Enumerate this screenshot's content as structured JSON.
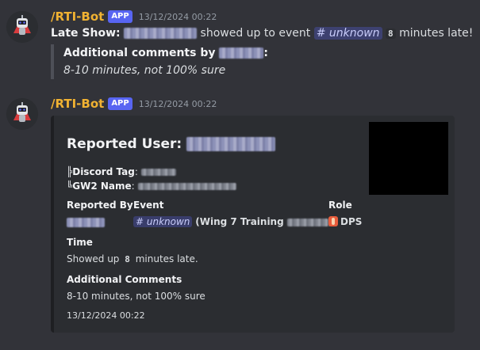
{
  "messages": [
    {
      "username": "/RTI-Bot",
      "badge": "APP",
      "timestamp": "13/12/2024 00:22",
      "content": {
        "late_show_label": "Late Show:",
        "showed_up_text": "showed up to event",
        "event_mention": "# unknown",
        "minutes_value": "8",
        "minutes_late_text": "minutes late!",
        "quote_title": "Additional comments by",
        "quote_colon": ":",
        "quote_text": "8-10 minutes, not 100% sure"
      }
    },
    {
      "username": "/RTI-Bot",
      "badge": "APP",
      "timestamp": "13/12/2024 00:22",
      "embed": {
        "title": "Reported User:",
        "discord_tag_label": "Discord Tag",
        "discord_tag_sep": ":",
        "gw2_name_label": "GW2 Name",
        "gw2_name_sep": ":",
        "tree_glyph_1": "╠",
        "tree_glyph_2": "╚",
        "reported_by_label": "Reported By",
        "event_label": "Event",
        "event_mention": "# unknown",
        "event_detail_prefix": "(Wing 7 Training",
        "event_detail_suffix": ")",
        "role_label": "Role",
        "role_value": "DPS",
        "time_label": "Time",
        "time_prefix": "Showed up",
        "time_minutes": "8",
        "time_suffix": "minutes late.",
        "comments_label": "Additional Comments",
        "comments_value": "8-10 minutes, not 100% sure",
        "footer_timestamp": "13/12/2024 00:22"
      }
    }
  ],
  "colors": {
    "background": "#323339",
    "username": "#f0b232",
    "badge": "#5865f2",
    "embed_bg": "#2b2d31",
    "mention": "#c9cdfb"
  },
  "icons": {
    "avatar": "robot-avatar-icon",
    "role": "dps-role-icon"
  }
}
